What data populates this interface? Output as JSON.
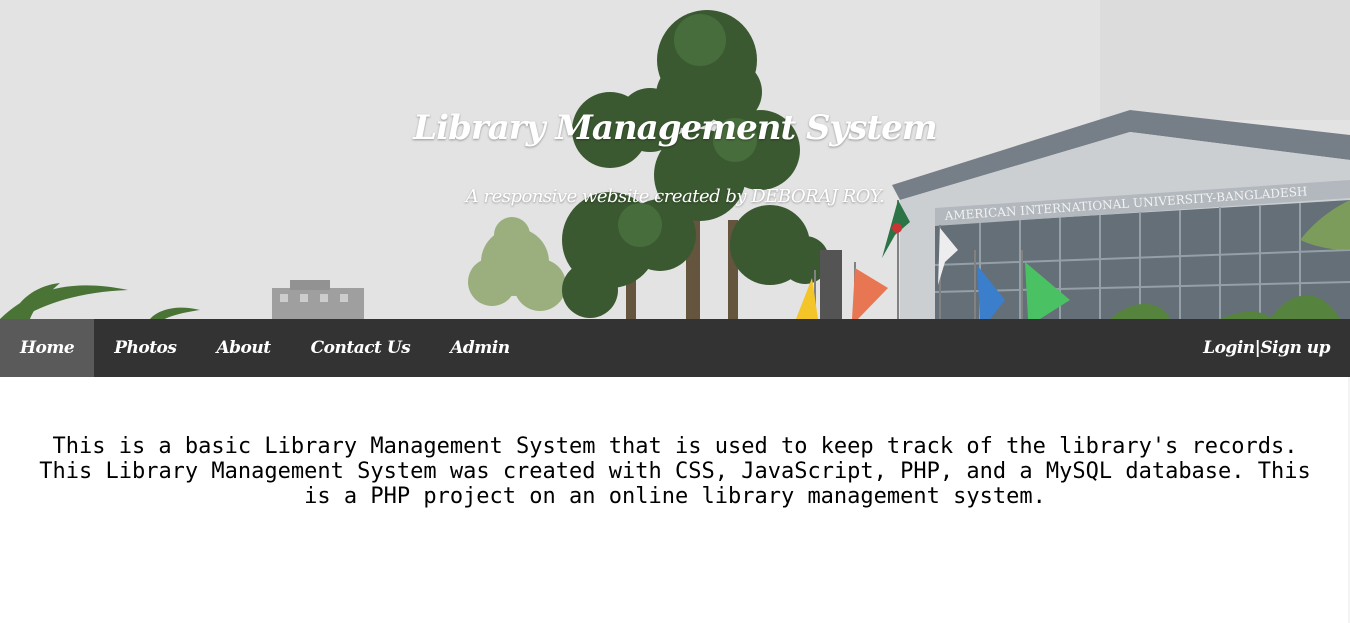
{
  "header": {
    "title": "Library Management System",
    "subtitle": "A responsive website created by DEBORAJ ROY.",
    "building_sign": "AMERICAN INTERNATIONAL UNIVERSITY-BANGLADESH"
  },
  "nav": {
    "items": [
      {
        "label": "Home",
        "active": true
      },
      {
        "label": "Photos",
        "active": false
      },
      {
        "label": "About",
        "active": false
      },
      {
        "label": "Contact Us",
        "active": false
      },
      {
        "label": "Admin",
        "active": false
      }
    ],
    "login_label": "Login|Sign up"
  },
  "main": {
    "paragraph_1": "This is a basic Library Management System that is used to keep track of the library's records.",
    "paragraph_2": "This Library Management System was created with CSS, JavaScript, PHP, and a MySQL database. This is a PHP project on an online library management system."
  },
  "colors": {
    "navbar_bg": "#333333",
    "nav_active_bg": "#5a5a5a",
    "nav_text": "#ffffff",
    "body_text": "#000000",
    "page_bg": "#ffffff"
  }
}
